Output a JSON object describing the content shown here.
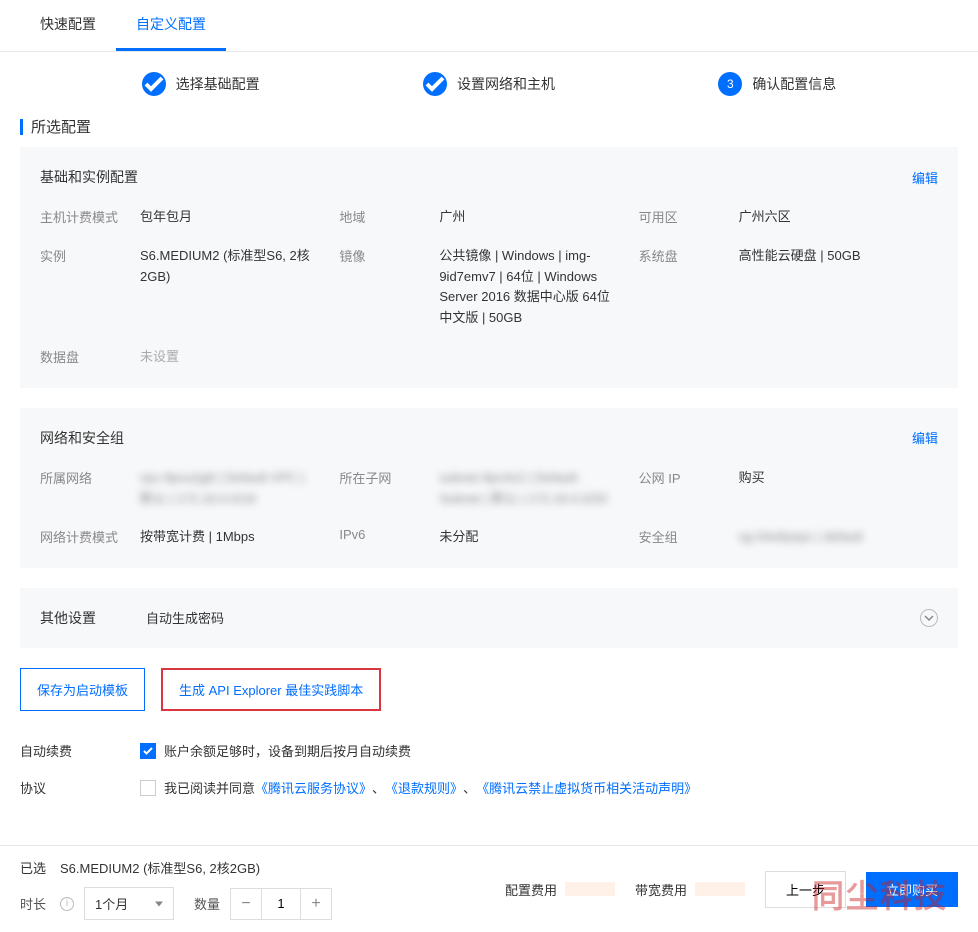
{
  "tabs": {
    "quick": "快速配置",
    "custom": "自定义配置"
  },
  "steps": {
    "s1": "选择基础配置",
    "s2": "设置网络和主机",
    "s3": "确认配置信息",
    "s3num": "3"
  },
  "section_title": "所选配置",
  "basic": {
    "title": "基础和实例配置",
    "edit": "编辑",
    "billing_label": "主机计费模式",
    "billing_value": "包年包月",
    "region_label": "地域",
    "region_value": "广州",
    "zone_label": "可用区",
    "zone_value": "广州六区",
    "instance_label": "实例",
    "instance_value": "S6.MEDIUM2 (标准型S6, 2核2GB)",
    "image_label": "镜像",
    "image_value": "公共镜像 | Windows | img-9id7emv7 | 64位 | Windows Server 2016 数据中心版 64位中文版 | 50GB",
    "sysdisk_label": "系统盘",
    "sysdisk_value": "高性能云硬盘 | 50GB",
    "datadisk_label": "数据盘",
    "datadisk_value": "未设置"
  },
  "network": {
    "title": "网络和安全组",
    "edit": "编辑",
    "net_label": "所属网络",
    "net_value": "vpc-8pvu2g8 | Default-VPC | 默认 | 172.16.0.0/16",
    "subnet_label": "所在子网",
    "subnet_value": "subnet-9pv3v2 | Default-Subnet | 默认 | 172.16.0.0/20",
    "eip_label": "公网 IP",
    "eip_value": "购买",
    "netbill_label": "网络计费模式",
    "netbill_value": "按带宽计费 | 1Mbps",
    "ipv6_label": "IPv6",
    "ipv6_value": "未分配",
    "sg_label": "安全组",
    "sg_value": "sg-04o8yepc | default"
  },
  "other": {
    "title": "其他设置",
    "summary": "自动生成密码"
  },
  "buttons": {
    "save_template": "保存为启动模板",
    "gen_script": "生成 API Explorer 最佳实践脚本"
  },
  "renew": {
    "label": "自动续费",
    "text": "账户余额足够时，设备到期后按月自动续费"
  },
  "agreement": {
    "label": "协议",
    "prefix": "我已阅读并同意",
    "link1": "《腾讯云服务协议》",
    "sep1": "、",
    "link2": "《退款规则》",
    "sep2": "、",
    "link3": "《腾讯云禁止虚拟货币相关活动声明》"
  },
  "footer": {
    "selected_label": "已选",
    "selected_value": "S6.MEDIUM2 (标准型S6, 2核2GB)",
    "duration_label": "时长",
    "duration_value": "1个月",
    "qty_label": "数量",
    "qty_value": "1",
    "config_cost": "配置费用",
    "bw_cost": "带宽费用",
    "prev": "上一步",
    "buy": "立即购买"
  },
  "watermark": "同尘科技"
}
